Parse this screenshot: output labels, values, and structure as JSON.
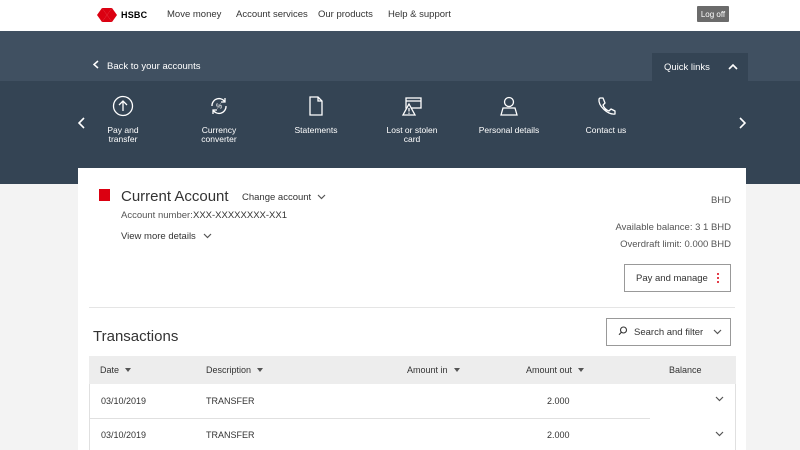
{
  "nav": {
    "brand": "HSBC",
    "links": [
      "Move money",
      "Account services",
      "Our products",
      "Help & support"
    ],
    "logoff": "Log off"
  },
  "band": {
    "back": "Back to your accounts",
    "quick_links": "Quick links",
    "items": [
      {
        "label1": "Pay and",
        "label2": "transfer",
        "icon": "arrow-up-circle-icon"
      },
      {
        "label1": "Currency",
        "label2": "converter",
        "icon": "currency-exchange-icon"
      },
      {
        "label1": "Statements",
        "label2": "",
        "icon": "document-icon"
      },
      {
        "label1": "Lost or stolen",
        "label2": "card",
        "icon": "card-alert-icon"
      },
      {
        "label1": "Personal details",
        "label2": "",
        "icon": "person-icon"
      },
      {
        "label1": "Contact us",
        "label2": "",
        "icon": "phone-icon"
      }
    ]
  },
  "account": {
    "title": "Current Account",
    "change": "Change account",
    "number_label": "Account number:",
    "number": "XXX-XXXXXXXX-XX1",
    "more": "View more details",
    "currency": "BHD",
    "available": "Available balance: 3 1 BHD",
    "overdraft": "Overdraft limit: 0.000 BHD",
    "pay_manage": "Pay and manage"
  },
  "transactions": {
    "title": "Transactions",
    "search": "Search and filter",
    "headers": {
      "date": "Date",
      "description": "Description",
      "amount_in": "Amount in",
      "amount_out": "Amount out",
      "balance": "Balance"
    },
    "rows": [
      {
        "date": "03/10/2019",
        "description": "TRANSFER",
        "amount_in": "",
        "amount_out": "2.000",
        "balance": ""
      },
      {
        "date": "03/10/2019",
        "description": "TRANSFER",
        "amount_in": "",
        "amount_out": "2.000",
        "balance": ""
      }
    ]
  },
  "colors": {
    "brand_red": "#db0011",
    "band_dark": "#344454",
    "band_light": "#405061"
  }
}
